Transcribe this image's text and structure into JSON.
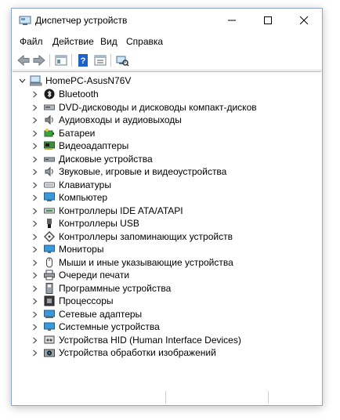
{
  "window": {
    "title": "Диспетчер устройств"
  },
  "menu": [
    "Файл",
    "Действие",
    "Вид",
    "Справка"
  ],
  "toolbar": {
    "icons": [
      "back-icon",
      "forward-icon",
      "properties-icon",
      "help-icon",
      "view-icon",
      "scan-hardware-icon"
    ]
  },
  "tree": {
    "root": "HomePC-AsusN76V",
    "items": [
      {
        "label": "Bluetooth",
        "icon": "bluetooth-icon"
      },
      {
        "label": "DVD-дисководы и дисководы компакт-дисков",
        "icon": "dvd-drive-icon"
      },
      {
        "label": "Аудиовходы и аудиовыходы",
        "icon": "audio-io-icon"
      },
      {
        "label": "Батареи",
        "icon": "battery-icon"
      },
      {
        "label": "Видеоадаптеры",
        "icon": "display-adapter-icon"
      },
      {
        "label": "Дисковые устройства",
        "icon": "disk-drive-icon"
      },
      {
        "label": "Звуковые, игровые и видеоустройства",
        "icon": "speaker-icon"
      },
      {
        "label": "Клавиатуры",
        "icon": "keyboard-icon"
      },
      {
        "label": "Компьютер",
        "icon": "computer-icon"
      },
      {
        "label": "Контроллеры IDE ATA/ATAPI",
        "icon": "ide-controller-icon"
      },
      {
        "label": "Контроллеры USB",
        "icon": "usb-icon"
      },
      {
        "label": "Контроллеры запоминающих устройств",
        "icon": "storage-controller-icon"
      },
      {
        "label": "Мониторы",
        "icon": "monitor-icon"
      },
      {
        "label": "Мыши и иные указывающие устройства",
        "icon": "mouse-icon"
      },
      {
        "label": "Очереди печати",
        "icon": "printer-icon"
      },
      {
        "label": "Программные устройства",
        "icon": "software-device-icon"
      },
      {
        "label": "Процессоры",
        "icon": "processor-icon"
      },
      {
        "label": "Сетевые адаптеры",
        "icon": "network-adapter-icon"
      },
      {
        "label": "Системные устройства",
        "icon": "system-device-icon"
      },
      {
        "label": "Устройства HID (Human Interface Devices)",
        "icon": "hid-icon"
      },
      {
        "label": "Устройства обработки изображений",
        "icon": "imaging-device-icon"
      }
    ]
  },
  "colors": {
    "border": "#8fa7c6",
    "help_blue": "#1e62c8",
    "monitor_blue": "#3a9ad9"
  }
}
